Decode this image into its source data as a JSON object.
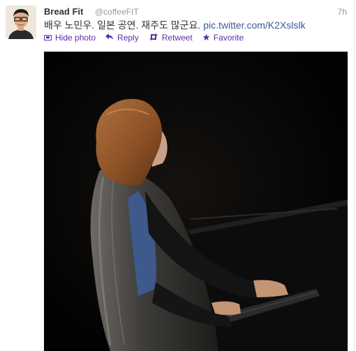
{
  "tweet": {
    "fullname": "Bread Fit",
    "username": "@coffeeFIT",
    "time": "7h",
    "text": "배우 노민우. 일본 공연. 재주도 많군요.",
    "link": "pic.twitter.com/K2Xslslk",
    "actions": {
      "hide_photo": "Hide photo",
      "reply": "Reply",
      "retweet": "Retweet",
      "favorite": "Favorite"
    }
  },
  "icons": {
    "hide_photo": "photo-icon",
    "reply": "reply-arrow-icon",
    "retweet": "retweet-icon",
    "favorite": "star-icon"
  },
  "colors": {
    "action": "#5b2ca5",
    "link": "#3b5998",
    "muted": "#999999",
    "photo_bg": "#050403"
  }
}
